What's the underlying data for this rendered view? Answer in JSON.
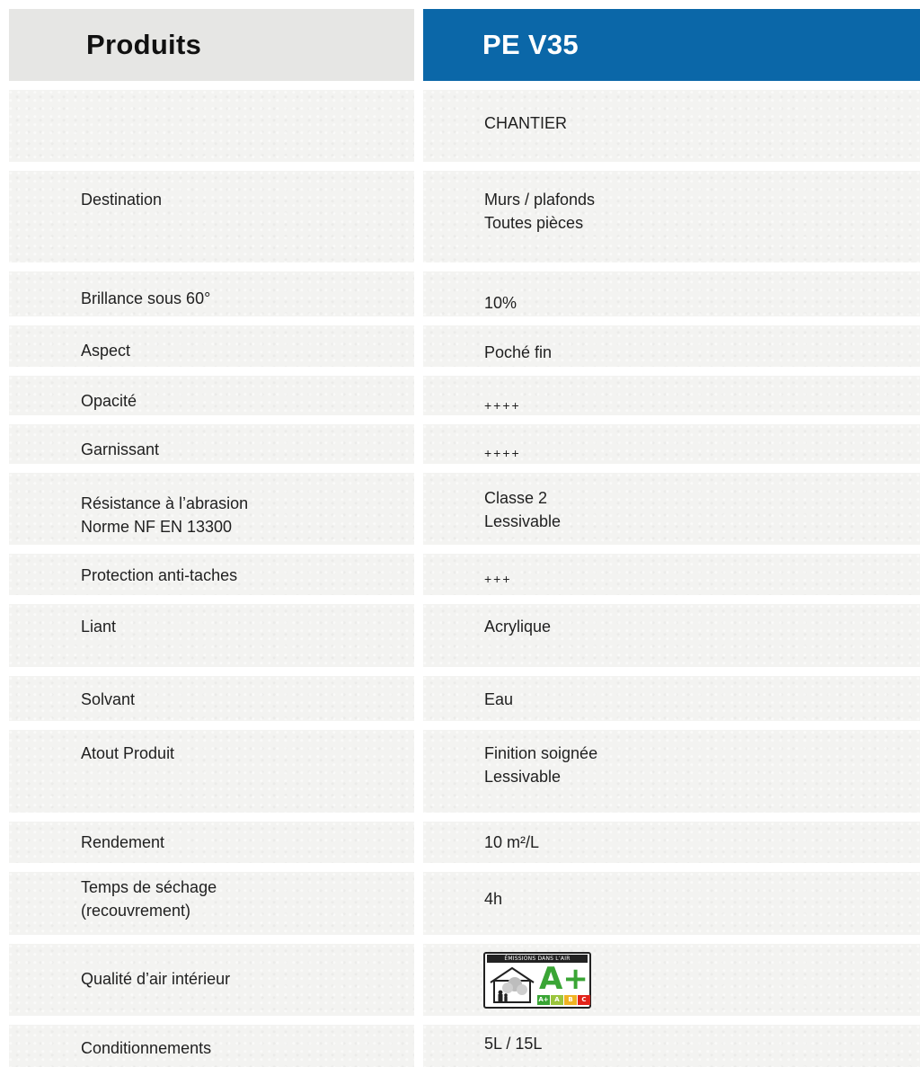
{
  "header": {
    "left": "Produits",
    "right": "PE V35"
  },
  "rows": [
    {
      "label": "",
      "value": "CHANTIER"
    },
    {
      "label": "Destination",
      "value": "Murs / plafonds",
      "value2": "Toutes pièces"
    },
    {
      "label": "Brillance sous 60°",
      "value": "10%"
    },
    {
      "label": "Aspect",
      "value": "Poché fin"
    },
    {
      "label": "Opacité",
      "value": "++++"
    },
    {
      "label": "Garnissant",
      "value": "++++"
    },
    {
      "label": "Résistance à l’abrasion",
      "label2": "Norme NF EN 13300",
      "value": "Classe 2",
      "value2": "Lessivable"
    },
    {
      "label": "Protection anti-taches",
      "value": "+++"
    },
    {
      "label": "Liant",
      "value": "Acrylique"
    },
    {
      "label": "Solvant",
      "value": "Eau"
    },
    {
      "label": "Atout Produit",
      "value": "Finition soignée",
      "value2": "Lessivable"
    },
    {
      "label": "Rendement",
      "value": "10 m²/L"
    },
    {
      "label": "Temps de séchage",
      "label2": "(recouvrement)",
      "value": "4h"
    },
    {
      "label": "Qualité d’air intérieur",
      "value": ""
    },
    {
      "label": "Conditionnements",
      "value": "5L / 15L"
    }
  ],
  "air_badge": {
    "title": "ÉMISSIONS DANS L’AIR INTÉRIEUR*",
    "grade": "A+",
    "scale": [
      "A+",
      "A",
      "B",
      "C"
    ],
    "scale_colors": [
      "#3aa535",
      "#9bc53d",
      "#f0b323",
      "#e2231a"
    ],
    "icon": "house-family-icon"
  },
  "colors": {
    "header_accent": "#0b67a8",
    "header_neutral": "#e6e6e4",
    "cell_background": "#f3f3f1"
  }
}
